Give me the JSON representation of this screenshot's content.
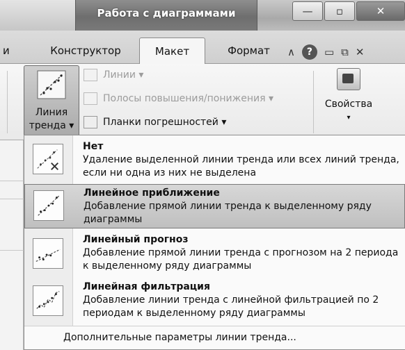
{
  "window": {
    "context_title": "Работа с диаграммами",
    "minimize_glyph": "—",
    "maximize_glyph": "▫",
    "close_glyph": "✕"
  },
  "tabs": {
    "cut_label": "и",
    "items": [
      {
        "label": "Конструктор"
      },
      {
        "label": "Макет",
        "active": true
      },
      {
        "label": "Формат"
      }
    ],
    "icons": [
      "caret-up-icon",
      "help-icon",
      "minimize-ribbon-icon",
      "restore-icon",
      "close-icon"
    ],
    "caret_glyph": "∧",
    "help_glyph": "?",
    "min_glyph": "▭",
    "restore_glyph": "⧉",
    "close_glyph": "✕"
  },
  "ribbon": {
    "trend_button": {
      "line1": "Линия",
      "line2": "тренда ▾"
    },
    "items": [
      {
        "label": "Линии ▾",
        "enabled": false
      },
      {
        "label": "Полосы повышения/понижения ▾",
        "enabled": false
      },
      {
        "label": "Планки погрешностей ▾",
        "enabled": true
      }
    ],
    "properties": {
      "label": "Свойства",
      "arrow": "▾"
    }
  },
  "menu": {
    "items": [
      {
        "title": "Нет",
        "description": "Удаление выделенной линии тренда или всех линий тренда, если ни одна из них не выделена",
        "icon": "no-trendline-icon",
        "highlighted": false
      },
      {
        "title": "Линейное приближение",
        "description": "Добавление прямой линии тренда к выделенному ряду диаграммы",
        "icon": "linear-trendline-icon",
        "highlighted": true
      },
      {
        "title": "Линейный прогноз",
        "description": "Добавление прямой линии тренда с прогнозом на 2 периода к выделенному ряду диаграммы",
        "icon": "linear-forecast-icon",
        "highlighted": false
      },
      {
        "title": "Линейная фильтрация",
        "description": "Добавление линии тренда с линейной фильтрацией по 2 периодам к выделенному ряду диаграммы",
        "icon": "moving-average-icon",
        "highlighted": false
      }
    ],
    "footer": "Дополнительные параметры линии тренда..."
  }
}
